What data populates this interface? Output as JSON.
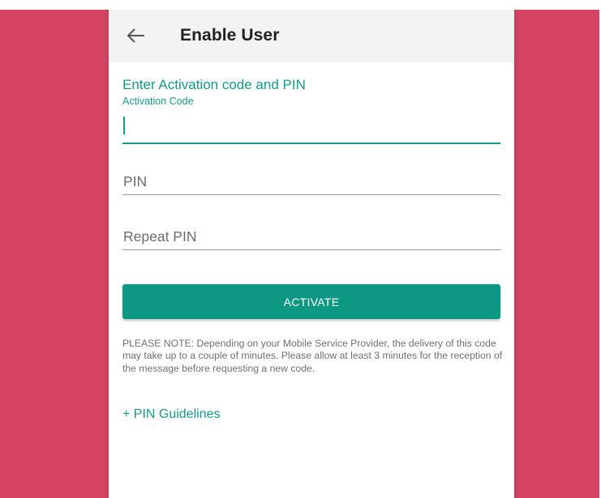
{
  "colors": {
    "side_background": "#d54563",
    "accent": "#159a88",
    "button": "#0c9882",
    "toolbar": "#f3f3f3"
  },
  "toolbar": {
    "back_icon": "arrow-left-icon",
    "title": "Enable User"
  },
  "form": {
    "heading": "Enter Activation code and PIN",
    "activation_code": {
      "label": "Activation Code",
      "value": ""
    },
    "pin": {
      "placeholder": "PIN",
      "value": ""
    },
    "repeat_pin": {
      "placeholder": "Repeat PIN",
      "value": ""
    },
    "activate_label": "ACTIVATE"
  },
  "note": "PLEASE NOTE: Depending on your Mobile Service Provider, the delivery of this code may take up to a couple of minutes. Please allow at least 3 minutes for the reception of the message before requesting a new code.",
  "pin_guidelines_label": "+ PIN Guidelines"
}
